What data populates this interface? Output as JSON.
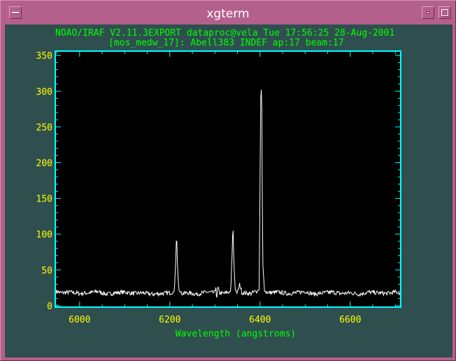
{
  "window": {
    "title": "xgterm"
  },
  "header": {
    "line1": "NOAO/IRAF V2.11.3EXPORT dataproc@vela Tue 17:56:25 28-Aug-2001",
    "line2": "[mos_medw_17]: Abell383 INDEF ap:17 beam:17"
  },
  "colors": {
    "window": "#b4608c",
    "terminal_bg": "#2f4f4f",
    "axes": "#00ffff",
    "tick_labels": "#ffff00",
    "header_text": "#00ff00",
    "spectrum": "#ffffff"
  },
  "icons": {
    "menu": "window-menu-icon",
    "minimize": "minimize-icon",
    "maximize": "maximize-icon"
  },
  "chart_data": {
    "type": "line",
    "title": "",
    "xlabel": "Wavelength (angstroms)",
    "ylabel": "",
    "xlim": [
      5946,
      6712
    ],
    "ylim": [
      -2,
      356
    ],
    "x_ticks": [
      6000,
      6200,
      6400,
      6600
    ],
    "y_ticks": [
      0,
      50,
      100,
      150,
      200,
      250,
      300,
      350
    ],
    "grid": false,
    "series": [
      {
        "baseline": 18,
        "noise": 3,
        "x": [
          5948,
          5960,
          5980,
          6000,
          6020,
          6040,
          6060,
          6080,
          6100,
          6120,
          6140,
          6160,
          6180,
          6200,
          6210,
          6213,
          6215,
          6217,
          6220,
          6225,
          6240,
          6260,
          6280,
          6300,
          6302,
          6304,
          6306,
          6310,
          6320,
          6335,
          6338,
          6340,
          6342,
          6345,
          6350,
          6355,
          6360,
          6380,
          6398,
          6400,
          6402,
          6404,
          6406,
          6410,
          6420,
          6440,
          6460,
          6480,
          6500,
          6520,
          6540,
          6560,
          6580,
          6600,
          6620,
          6640,
          6660,
          6680,
          6700,
          6710
        ],
        "y": [
          20,
          18,
          19,
          17,
          18,
          20,
          16,
          18,
          19,
          17,
          18,
          16,
          17,
          18,
          20,
          60,
          104,
          55,
          22,
          17,
          18,
          16,
          19,
          18,
          28,
          5,
          26,
          18,
          17,
          20,
          70,
          116,
          60,
          22,
          18,
          30,
          18,
          17,
          22,
          170,
          320,
          275,
          60,
          20,
          18,
          19,
          17,
          18,
          20,
          16,
          18,
          19,
          17,
          18,
          16,
          19,
          18,
          17,
          19,
          18
        ]
      }
    ]
  }
}
